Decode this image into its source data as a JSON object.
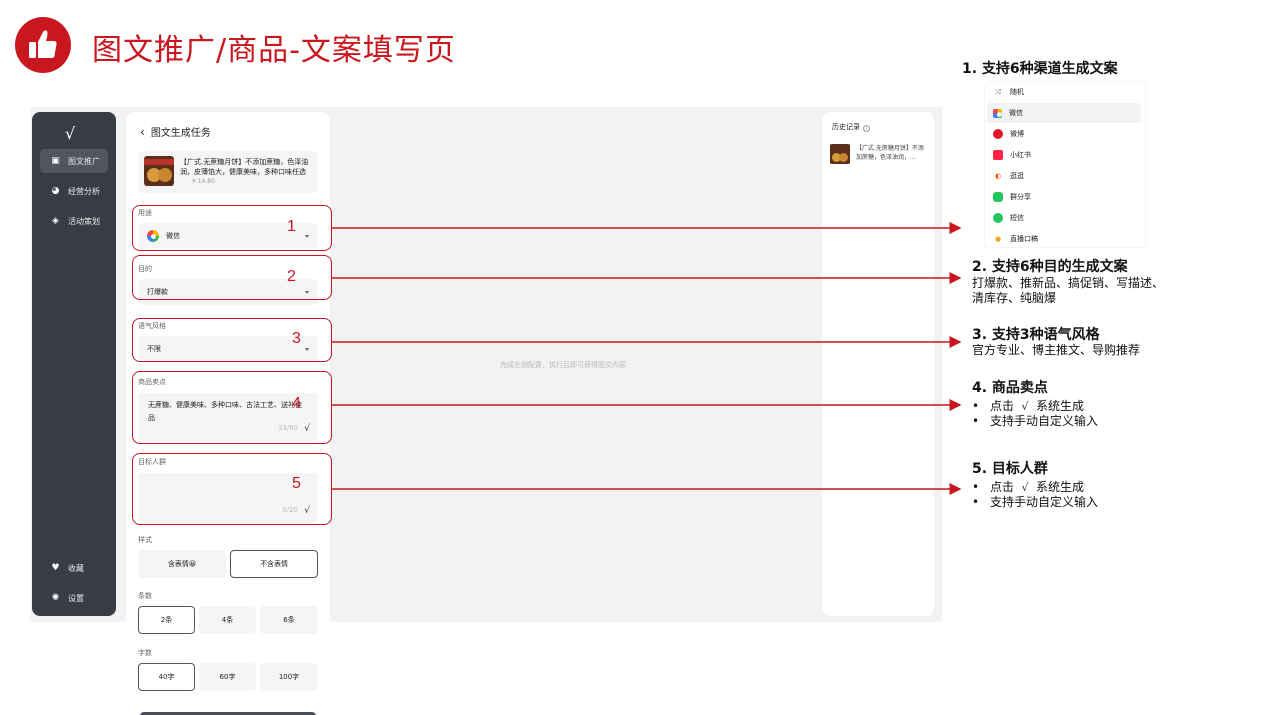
{
  "slide": {
    "title": "图文推广/商品-文案填写页"
  },
  "sidebar": {
    "logo": "√",
    "items": [
      {
        "label": "图文推广",
        "active": true
      },
      {
        "label": "经营分析",
        "active": false
      },
      {
        "label": "活动策划",
        "active": false
      }
    ],
    "bottom_items": [
      {
        "label": "收藏"
      },
      {
        "label": "设置"
      }
    ]
  },
  "panel": {
    "back_label": "图文生成任务",
    "product": {
      "text": "【广式.无蔗糖月饼】不添加蔗糖，色泽油润，皮薄馅大，健康美味，多种口味任选",
      "price": "¥ 14.80"
    },
    "purpose": {
      "label": "用途",
      "value": "微信"
    },
    "goal": {
      "label": "目的",
      "value": "打爆款"
    },
    "tone": {
      "label": "语气风格",
      "value": "不限"
    },
    "selling_points": {
      "label": "商品卖点",
      "value": "无蔗糖、健康美味、多种口味、古法工艺、送礼佳品",
      "counter": "33/60"
    },
    "audience": {
      "label": "目标人群",
      "value": "",
      "counter": "0/20"
    },
    "style": {
      "label": "样式",
      "options": [
        "含表情😀",
        "不含表情"
      ],
      "selected": 1
    },
    "count": {
      "label": "条数",
      "options": [
        "2条",
        "4条",
        "6条"
      ],
      "selected": 0
    },
    "words": {
      "label": "字数",
      "options": [
        "40字",
        "60字",
        "100字"
      ],
      "selected": 0
    }
  },
  "main": {
    "placeholder": "完成左侧配置，执行后即可获得图文内容"
  },
  "history": {
    "title": "历史记录",
    "items": [
      {
        "text": "【广式.无蔗糖月饼】不添加蔗糖，色泽油润，..."
      }
    ]
  },
  "callouts": {
    "numbers": [
      "1",
      "2",
      "3",
      "4",
      "5"
    ]
  },
  "notes": {
    "n1": {
      "heading": "1.  支持6种渠道生成文案"
    },
    "n2": {
      "heading": "2.  支持6种目的生成文案",
      "line1": "打爆款、推新品、搞促销、写描述、",
      "line2": "清库存、纯脑爆"
    },
    "n3": {
      "heading": "3.  支持3种语气风格",
      "line1": "官方专业、博主推文、导购推荐"
    },
    "n4": {
      "heading": "4.  商品卖点",
      "b1_pre": "点击",
      "b1_post": "系统生成",
      "b2": "支持手动自定义输入"
    },
    "n5": {
      "heading": "5.  目标人群",
      "b1_pre": "点击",
      "b1_post": "系统生成",
      "b2": "支持手动自定义输入"
    },
    "bullet_char": "•"
  },
  "channels": {
    "items": [
      {
        "label": "随机",
        "color": "#6b7280",
        "icon": "shuffle-icon"
      },
      {
        "label": "微信",
        "color": "#22c55e",
        "icon": "wechat-icon",
        "selected": true
      },
      {
        "label": "微博",
        "color": "#e6162d",
        "icon": "weibo-icon"
      },
      {
        "label": "小红书",
        "color": "#ff2442",
        "icon": "xiaohongshu-icon"
      },
      {
        "label": "逛逛",
        "color": "#ff5000",
        "icon": "guangguang-icon"
      },
      {
        "label": "群分享",
        "color": "#22c55e",
        "icon": "group-share-icon"
      },
      {
        "label": "短信",
        "color": "#22c55e",
        "icon": "sms-icon"
      },
      {
        "label": "直播口稿",
        "color": "#f5a623",
        "icon": "microphone-icon"
      }
    ]
  },
  "colors": {
    "accent_red": "#c8171e",
    "sidebar_bg": "#383c44"
  }
}
